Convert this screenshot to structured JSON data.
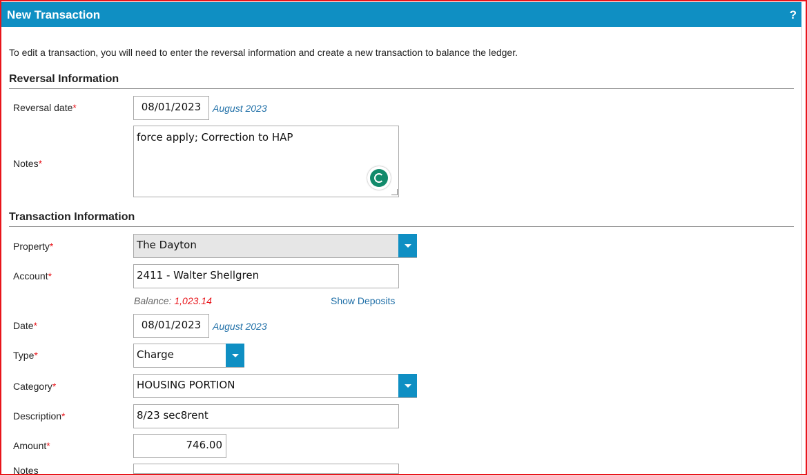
{
  "window": {
    "title": "New Transaction",
    "help_label": "?"
  },
  "intro_text": "To edit a transaction, you will need to enter the reversal information and create a new transaction to balance the ledger.",
  "reversal": {
    "heading": "Reversal Information",
    "date_label": "Reversal date",
    "date_value": "08/01/2023",
    "date_period": "August 2023",
    "notes_label": "Notes",
    "notes_value": "force apply; Correction to HAP"
  },
  "transaction": {
    "heading": "Transaction Information",
    "property_label": "Property",
    "property_value": "The Dayton",
    "account_label": "Account",
    "account_value": "2411 - Walter Shellgren",
    "balance_label": "Balance:",
    "balance_value": "1,023.14",
    "show_deposits_label": "Show Deposits",
    "date_label": "Date",
    "date_value": "08/01/2023",
    "date_period": "August 2023",
    "type_label": "Type",
    "type_value": "Charge",
    "category_label": "Category",
    "category_value": "HOUSING PORTION",
    "description_label": "Description",
    "description_value": "8/23 sec8rent",
    "amount_label": "Amount",
    "amount_value": "746.00",
    "notes_label": "Notes"
  },
  "required_marker": "*",
  "colors": {
    "accent": "#0f8fc3",
    "required": "#e8151b",
    "link": "#1f6fa7",
    "frame": "#e8151b"
  }
}
